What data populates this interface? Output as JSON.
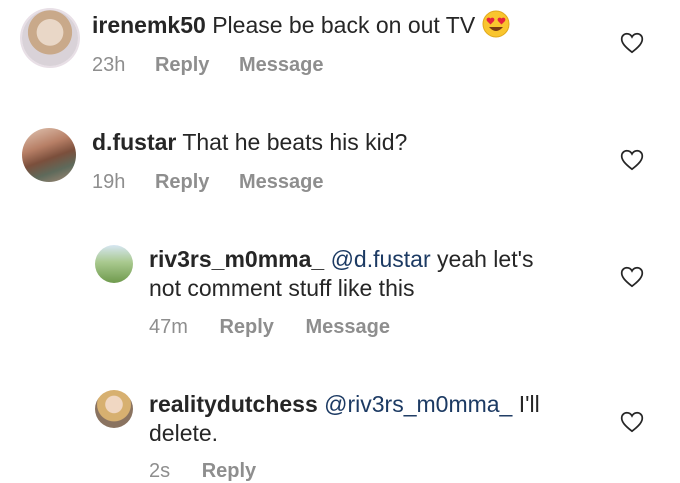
{
  "comments": [
    {
      "username": "irenemk50",
      "text": "Please be back on out TV",
      "emoji": "heart-eyes",
      "time": "23h",
      "reply": "Reply",
      "message": "Message"
    },
    {
      "username": "d.fustar",
      "text": "That he beats his kid?",
      "time": "19h",
      "reply": "Reply",
      "message": "Message"
    },
    {
      "username": "riv3rs_m0mma_",
      "mention": "@d.fustar",
      "text_line1": "yeah let's",
      "text_line2": "not comment stuff like this",
      "time": "47m",
      "reply": "Reply",
      "message": "Message"
    },
    {
      "username": "realitydutchess",
      "mention": "@riv3rs_m0mma_",
      "text_line1": "I'll",
      "text_line2": "delete.",
      "time": "2s",
      "reply": "Reply"
    }
  ],
  "icons": {
    "like": "heart-outline-icon",
    "emoji": "smiling-face-with-heart-eyes"
  },
  "colors": {
    "text": "#262626",
    "meta": "#8e8e8e",
    "mention": "#1c3a63"
  }
}
